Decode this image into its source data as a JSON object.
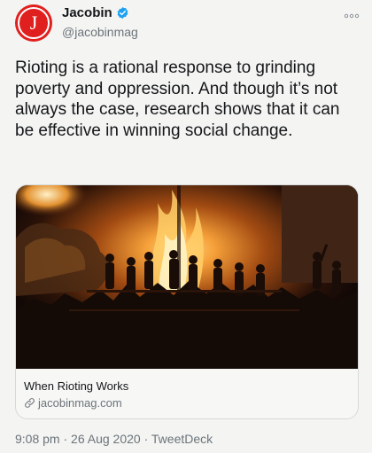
{
  "tweet": {
    "author": {
      "name": "Jacobin",
      "handle": "@jacobinmag",
      "avatar_letter": "J",
      "avatar_color": "#e0201f",
      "verified": true,
      "verified_icon": "verified-badge-icon"
    },
    "more_icon": "more-options-icon",
    "text": "Rioting is a rational response to grinding poverty and oppression. And though it’s not always the case, research shows that it can be effective in winning social change.",
    "link_card": {
      "image": "photo of crowd of people standing on structures in front of a large fire at night",
      "title": "When Rioting Works",
      "domain": "jacobinmag.com",
      "domain_icon": "link-icon"
    },
    "time": "9:08 pm",
    "separator": "·",
    "date": "26 Aug 2020",
    "source": "TweetDeck"
  },
  "colors": {
    "background": "#f4f4f2",
    "verified_blue": "#1da1f2",
    "secondary_text": "#6b747b"
  }
}
